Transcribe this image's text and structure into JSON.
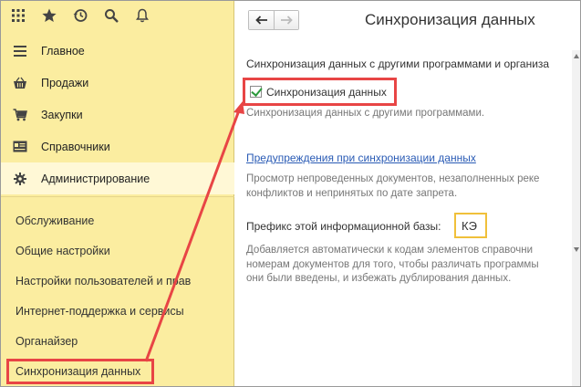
{
  "toolbar": {
    "icons": [
      "apps-grid-icon",
      "star-icon",
      "history-icon",
      "search-icon",
      "bell-icon"
    ]
  },
  "sections": [
    {
      "label": "Главное",
      "icon": "menu-icon"
    },
    {
      "label": "Продажи",
      "icon": "basket-icon"
    },
    {
      "label": "Закупки",
      "icon": "cart-icon"
    },
    {
      "label": "Справочники",
      "icon": "book-icon"
    },
    {
      "label": "Администрирование",
      "icon": "gear-icon"
    }
  ],
  "subnav": [
    "Обслуживание",
    "Общие настройки",
    "Настройки пользователей и прав",
    "Интернет-поддержка и сервисы",
    "Органайзер",
    "Синхронизация данных"
  ],
  "page": {
    "title": "Синхронизация данных",
    "section_title": "Синхронизация данных с другими программами и организа",
    "checkbox_label": "Синхронизация данных",
    "checkbox_checked": true,
    "checkbox_desc": "Синхронизация данных с другими программами.",
    "link": "Предупреждения при синхронизации данных",
    "link_desc_1": "Просмотр непроведенных документов, незаполненных реке",
    "link_desc_2": "конфликтов и непринятых по дате запрета.",
    "prefix_label": "Префикс этой информационной базы:",
    "prefix_value": "КЭ",
    "prefix_desc_1": "Добавляется автоматически к кодам элементов справочни",
    "prefix_desc_2": "номерам документов для того, чтобы различать программы",
    "prefix_desc_3": "они были введены, и избежать дублирования данных."
  },
  "colors": {
    "sidebar": "#fbeda0",
    "highlight": "#e84545",
    "link": "#2a5bb5",
    "input_border": "#f0c03a"
  }
}
